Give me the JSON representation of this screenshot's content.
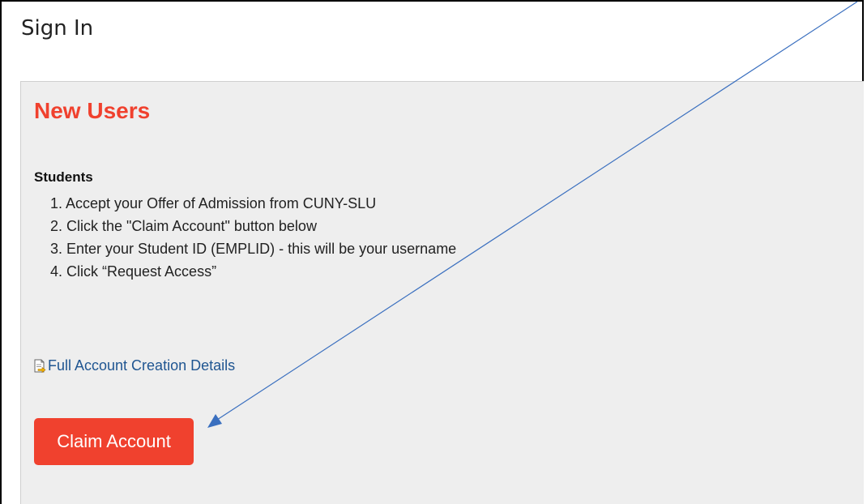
{
  "page": {
    "title": "Sign In"
  },
  "panel": {
    "heading": "New Users",
    "section_label": "Students",
    "steps": [
      "1. Accept your Offer of Admission from CUNY-SLU",
      "2. Click the \"Claim Account\" button below",
      "3. Enter your Student ID (EMPLID) - this will be your username",
      "4. Click “Request Access”"
    ],
    "details_link": {
      "label": "Full Account Creation Details",
      "icon": "document-arrow-icon"
    },
    "claim_button": {
      "label": "Claim Account"
    }
  },
  "colors": {
    "heading": "#f0412e",
    "button_bg": "#f0412e",
    "button_text": "#ffffff",
    "link": "#1f5591",
    "panel_bg": "#eeeeee",
    "annotation_arrow": "#3a6fbf"
  }
}
